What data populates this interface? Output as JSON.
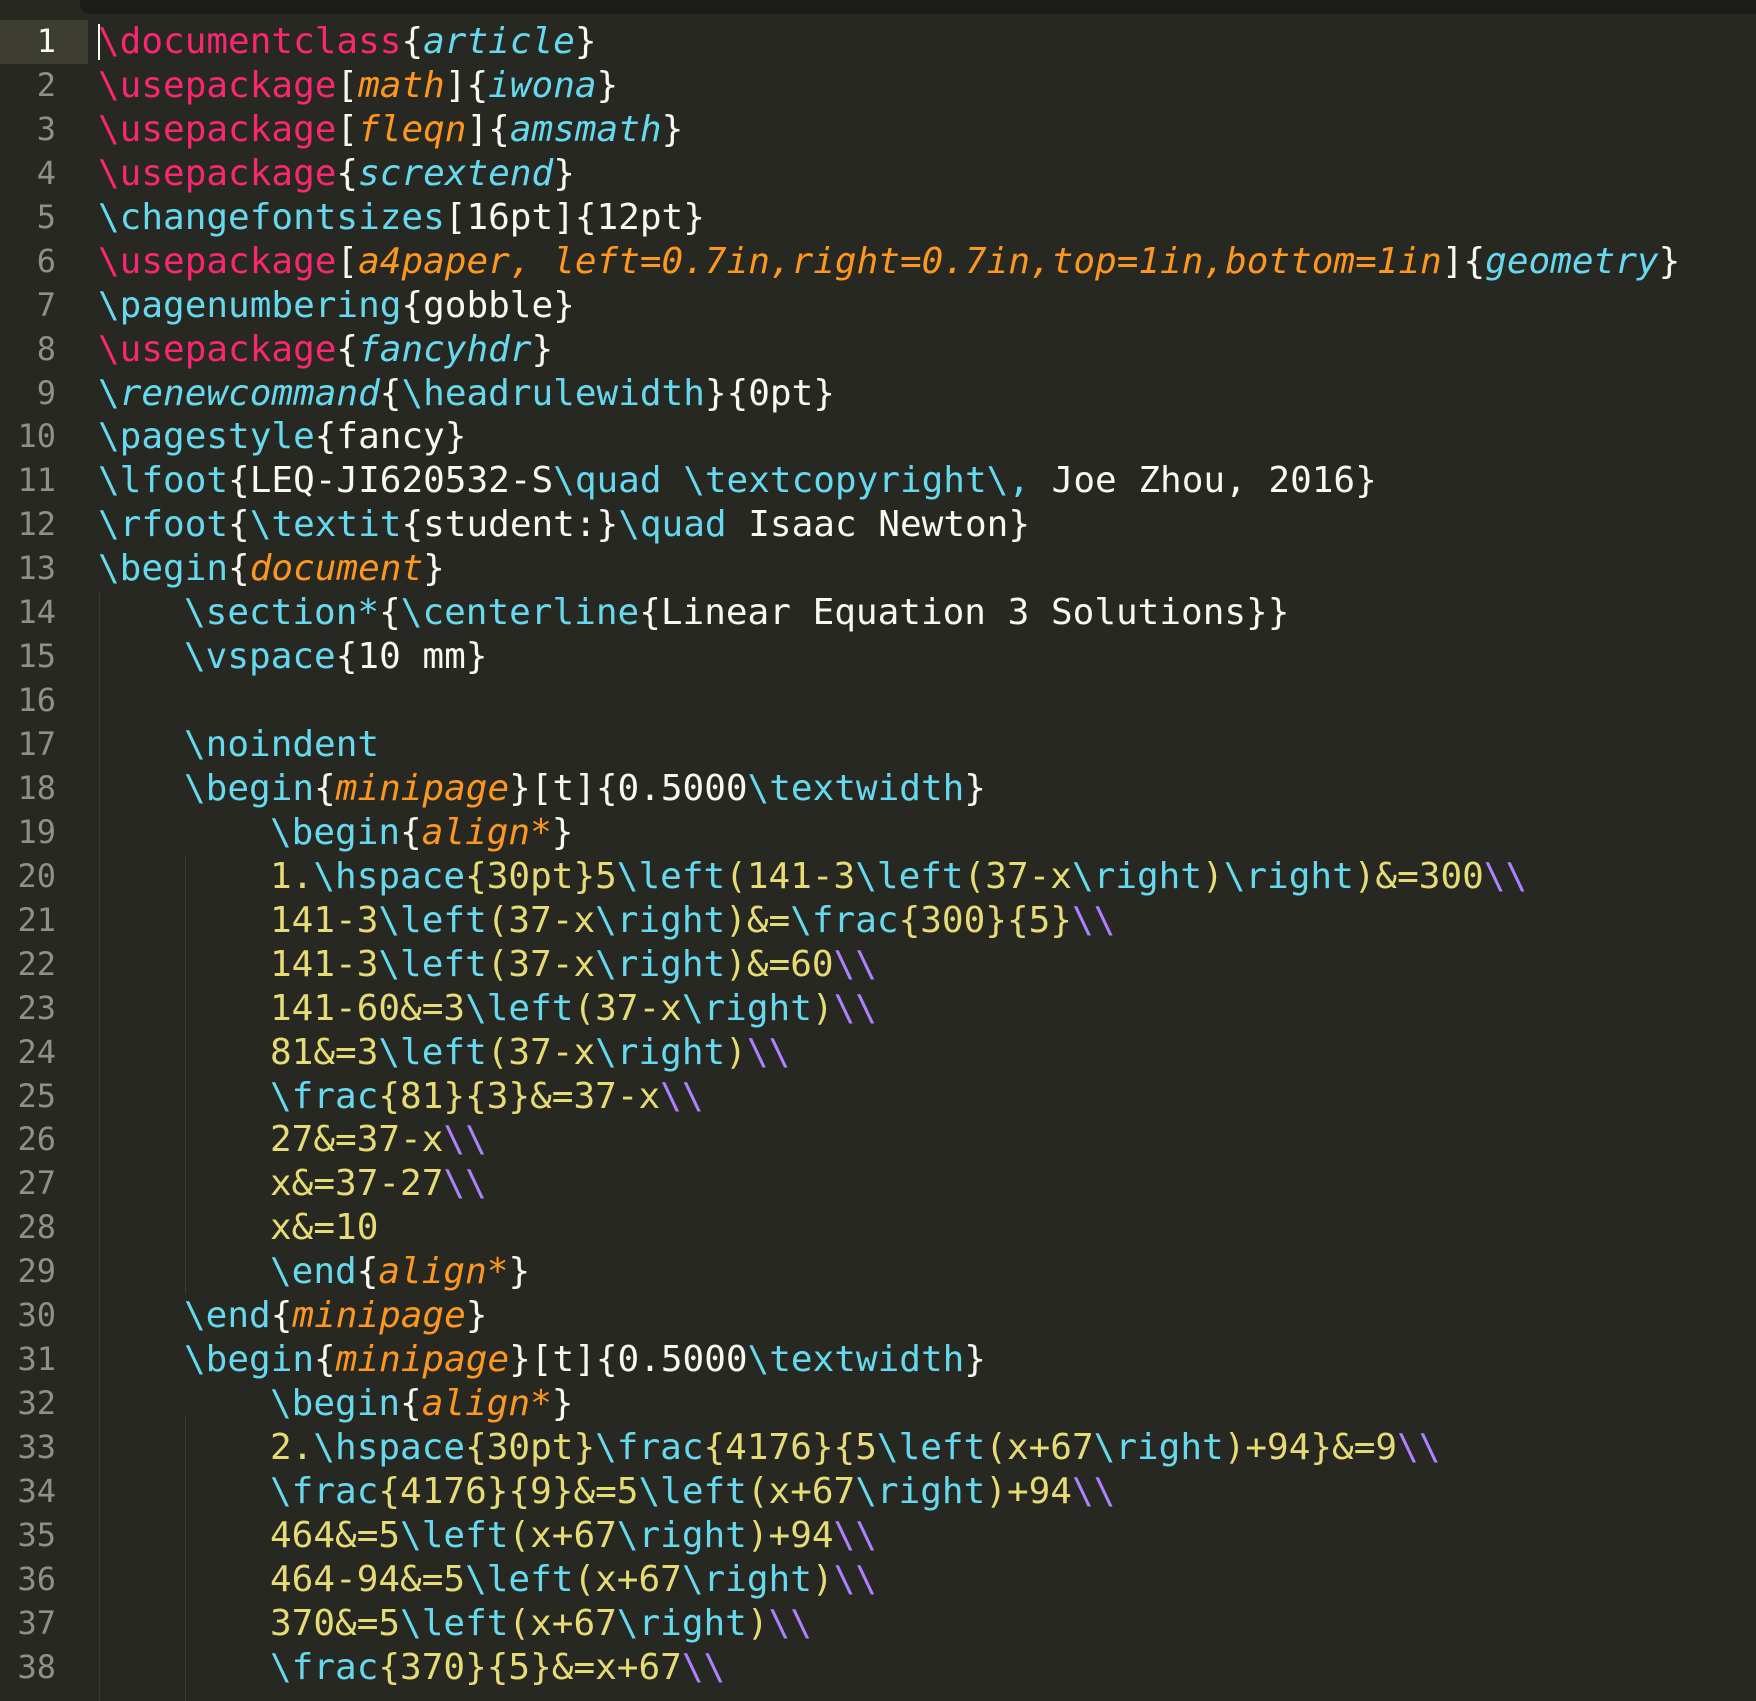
{
  "editor": {
    "language": "LaTeX",
    "theme": "Monokai",
    "active_line": "1",
    "colors": {
      "background": "#272822",
      "keyword": "#f92672",
      "command": "#66d9ef",
      "option": "#fd971f",
      "text": "#f8f8f2",
      "math": "#e6db74",
      "linebreak": "#ae81ff",
      "gutter_text": "#8f908a"
    },
    "line_numbers": [
      "1",
      "2",
      "3",
      "4",
      "5",
      "6",
      "7",
      "8",
      "9",
      "10",
      "11",
      "12",
      "13",
      "14",
      "15",
      "16",
      "17",
      "18",
      "19",
      "20",
      "21",
      "22",
      "23",
      "24",
      "25",
      "26",
      "27",
      "28",
      "29",
      "30",
      "31",
      "32",
      "33",
      "34",
      "35",
      "36",
      "37",
      "38"
    ]
  },
  "lines": [
    [
      {
        "c": "k",
        "t": "\\documentclass"
      },
      {
        "c": "w",
        "t": "{"
      },
      {
        "c": "ci",
        "t": "article"
      },
      {
        "c": "w",
        "t": "}"
      }
    ],
    [
      {
        "c": "k",
        "t": "\\usepackage"
      },
      {
        "c": "w",
        "t": "["
      },
      {
        "c": "o",
        "t": "math"
      },
      {
        "c": "w",
        "t": "]{"
      },
      {
        "c": "ci",
        "t": "iwona"
      },
      {
        "c": "w",
        "t": "}"
      }
    ],
    [
      {
        "c": "k",
        "t": "\\usepackage"
      },
      {
        "c": "w",
        "t": "["
      },
      {
        "c": "o",
        "t": "fleqn"
      },
      {
        "c": "w",
        "t": "]{"
      },
      {
        "c": "ci",
        "t": "amsmath"
      },
      {
        "c": "w",
        "t": "}"
      }
    ],
    [
      {
        "c": "k",
        "t": "\\usepackage"
      },
      {
        "c": "w",
        "t": "{"
      },
      {
        "c": "ci",
        "t": "scrextend"
      },
      {
        "c": "w",
        "t": "}"
      }
    ],
    [
      {
        "c": "c",
        "t": "\\changefontsizes"
      },
      {
        "c": "w",
        "t": "[16pt]{12pt}"
      }
    ],
    [
      {
        "c": "k",
        "t": "\\usepackage"
      },
      {
        "c": "w",
        "t": "["
      },
      {
        "c": "o",
        "t": "a4paper, left=0.7in,right=0.7in,top=1in,bottom=1in"
      },
      {
        "c": "w",
        "t": "]{"
      },
      {
        "c": "ci",
        "t": "geometry"
      },
      {
        "c": "w",
        "t": "}"
      }
    ],
    [
      {
        "c": "c",
        "t": "\\pagenumbering"
      },
      {
        "c": "w",
        "t": "{gobble}"
      }
    ],
    [
      {
        "c": "k",
        "t": "\\usepackage"
      },
      {
        "c": "w",
        "t": "{"
      },
      {
        "c": "ci",
        "t": "fancyhdr"
      },
      {
        "c": "w",
        "t": "}"
      }
    ],
    [
      {
        "c": "c",
        "t": "\\"
      },
      {
        "c": "ci",
        "t": "renewcommand"
      },
      {
        "c": "w",
        "t": "{"
      },
      {
        "c": "c",
        "t": "\\headrulewidth"
      },
      {
        "c": "w",
        "t": "}{0pt}"
      }
    ],
    [
      {
        "c": "c",
        "t": "\\pagestyle"
      },
      {
        "c": "w",
        "t": "{fancy}"
      }
    ],
    [
      {
        "c": "c",
        "t": "\\lfoot"
      },
      {
        "c": "w",
        "t": "{LEQ-JI620532-S"
      },
      {
        "c": "c",
        "t": "\\quad \\textcopyright\\,"
      },
      {
        "c": "w",
        "t": " Joe Zhou, 2016}"
      }
    ],
    [
      {
        "c": "c",
        "t": "\\rfoot"
      },
      {
        "c": "w",
        "t": "{"
      },
      {
        "c": "c",
        "t": "\\textit"
      },
      {
        "c": "w",
        "t": "{student:}"
      },
      {
        "c": "c",
        "t": "\\quad"
      },
      {
        "c": "w",
        "t": " Isaac Newton}"
      }
    ],
    [
      {
        "c": "c",
        "t": "\\begin"
      },
      {
        "c": "w",
        "t": "{"
      },
      {
        "c": "o",
        "t": "document"
      },
      {
        "c": "w",
        "t": "}"
      }
    ],
    [
      {
        "c": "c",
        "t": "\\section*"
      },
      {
        "c": "w",
        "t": "{"
      },
      {
        "c": "c",
        "t": "\\centerline"
      },
      {
        "c": "w",
        "t": "{Linear Equation 3 Solutions}}"
      }
    ],
    [
      {
        "c": "c",
        "t": "\\vspace"
      },
      {
        "c": "w",
        "t": "{10 mm}"
      }
    ],
    [],
    [
      {
        "c": "c",
        "t": "\\noindent"
      }
    ],
    [
      {
        "c": "c",
        "t": "\\begin"
      },
      {
        "c": "w",
        "t": "{"
      },
      {
        "c": "o",
        "t": "minipage"
      },
      {
        "c": "w",
        "t": "}[t]{0.5000"
      },
      {
        "c": "c",
        "t": "\\textwidth"
      },
      {
        "c": "w",
        "t": "}"
      }
    ],
    [
      {
        "c": "c",
        "t": "\\begin"
      },
      {
        "c": "w",
        "t": "{"
      },
      {
        "c": "o",
        "t": "align*"
      },
      {
        "c": "w",
        "t": "}"
      }
    ],
    [
      {
        "c": "y",
        "t": "1."
      },
      {
        "c": "c",
        "t": "\\hspace"
      },
      {
        "c": "y",
        "t": "{30pt}5"
      },
      {
        "c": "c",
        "t": "\\left"
      },
      {
        "c": "y",
        "t": "(141-3"
      },
      {
        "c": "c",
        "t": "\\left"
      },
      {
        "c": "y",
        "t": "(37-x"
      },
      {
        "c": "c",
        "t": "\\right"
      },
      {
        "c": "y",
        "t": ")"
      },
      {
        "c": "c",
        "t": "\\right"
      },
      {
        "c": "y",
        "t": ")&=300"
      },
      {
        "c": "p",
        "t": "\\\\"
      }
    ],
    [
      {
        "c": "y",
        "t": "141-3"
      },
      {
        "c": "c",
        "t": "\\left"
      },
      {
        "c": "y",
        "t": "(37-x"
      },
      {
        "c": "c",
        "t": "\\right"
      },
      {
        "c": "y",
        "t": ")&="
      },
      {
        "c": "c",
        "t": "\\frac"
      },
      {
        "c": "y",
        "t": "{300}{5}"
      },
      {
        "c": "p",
        "t": "\\\\"
      }
    ],
    [
      {
        "c": "y",
        "t": "141-3"
      },
      {
        "c": "c",
        "t": "\\left"
      },
      {
        "c": "y",
        "t": "(37-x"
      },
      {
        "c": "c",
        "t": "\\right"
      },
      {
        "c": "y",
        "t": ")&=60"
      },
      {
        "c": "p",
        "t": "\\\\"
      }
    ],
    [
      {
        "c": "y",
        "t": "141-60&=3"
      },
      {
        "c": "c",
        "t": "\\left"
      },
      {
        "c": "y",
        "t": "(37-x"
      },
      {
        "c": "c",
        "t": "\\right"
      },
      {
        "c": "y",
        "t": ")"
      },
      {
        "c": "p",
        "t": "\\\\"
      }
    ],
    [
      {
        "c": "y",
        "t": "81&=3"
      },
      {
        "c": "c",
        "t": "\\left"
      },
      {
        "c": "y",
        "t": "(37-x"
      },
      {
        "c": "c",
        "t": "\\right"
      },
      {
        "c": "y",
        "t": ")"
      },
      {
        "c": "p",
        "t": "\\\\"
      }
    ],
    [
      {
        "c": "c",
        "t": "\\frac"
      },
      {
        "c": "y",
        "t": "{81}{3}&=37-x"
      },
      {
        "c": "p",
        "t": "\\\\"
      }
    ],
    [
      {
        "c": "y",
        "t": "27&=37-x"
      },
      {
        "c": "p",
        "t": "\\\\"
      }
    ],
    [
      {
        "c": "y",
        "t": "x&=37-27"
      },
      {
        "c": "p",
        "t": "\\\\"
      }
    ],
    [
      {
        "c": "y",
        "t": "x&=10"
      }
    ],
    [
      {
        "c": "c",
        "t": "\\end"
      },
      {
        "c": "w",
        "t": "{"
      },
      {
        "c": "o",
        "t": "align*"
      },
      {
        "c": "w",
        "t": "}"
      }
    ],
    [
      {
        "c": "c",
        "t": "\\end"
      },
      {
        "c": "w",
        "t": "{"
      },
      {
        "c": "o",
        "t": "minipage"
      },
      {
        "c": "w",
        "t": "}"
      }
    ],
    [
      {
        "c": "c",
        "t": "\\begin"
      },
      {
        "c": "w",
        "t": "{"
      },
      {
        "c": "o",
        "t": "minipage"
      },
      {
        "c": "w",
        "t": "}[t]{0.5000"
      },
      {
        "c": "c",
        "t": "\\textwidth"
      },
      {
        "c": "w",
        "t": "}"
      }
    ],
    [
      {
        "c": "c",
        "t": "\\begin"
      },
      {
        "c": "w",
        "t": "{"
      },
      {
        "c": "o",
        "t": "align*"
      },
      {
        "c": "w",
        "t": "}"
      }
    ],
    [
      {
        "c": "y",
        "t": "2."
      },
      {
        "c": "c",
        "t": "\\hspace"
      },
      {
        "c": "y",
        "t": "{30pt}"
      },
      {
        "c": "c",
        "t": "\\frac"
      },
      {
        "c": "y",
        "t": "{4176}{5"
      },
      {
        "c": "c",
        "t": "\\left"
      },
      {
        "c": "y",
        "t": "(x+67"
      },
      {
        "c": "c",
        "t": "\\right"
      },
      {
        "c": "y",
        "t": ")+94}&=9"
      },
      {
        "c": "p",
        "t": "\\\\"
      }
    ],
    [
      {
        "c": "c",
        "t": "\\frac"
      },
      {
        "c": "y",
        "t": "{4176}{9}&=5"
      },
      {
        "c": "c",
        "t": "\\left"
      },
      {
        "c": "y",
        "t": "(x+67"
      },
      {
        "c": "c",
        "t": "\\right"
      },
      {
        "c": "y",
        "t": ")+94"
      },
      {
        "c": "p",
        "t": "\\\\"
      }
    ],
    [
      {
        "c": "y",
        "t": "464&=5"
      },
      {
        "c": "c",
        "t": "\\left"
      },
      {
        "c": "y",
        "t": "(x+67"
      },
      {
        "c": "c",
        "t": "\\right"
      },
      {
        "c": "y",
        "t": ")+94"
      },
      {
        "c": "p",
        "t": "\\\\"
      }
    ],
    [
      {
        "c": "y",
        "t": "464-94&=5"
      },
      {
        "c": "c",
        "t": "\\left"
      },
      {
        "c": "y",
        "t": "(x+67"
      },
      {
        "c": "c",
        "t": "\\right"
      },
      {
        "c": "y",
        "t": ")"
      },
      {
        "c": "p",
        "t": "\\\\"
      }
    ],
    [
      {
        "c": "y",
        "t": "370&=5"
      },
      {
        "c": "c",
        "t": "\\left"
      },
      {
        "c": "y",
        "t": "(x+67"
      },
      {
        "c": "c",
        "t": "\\right"
      },
      {
        "c": "y",
        "t": ")"
      },
      {
        "c": "p",
        "t": "\\\\"
      }
    ],
    [
      {
        "c": "c",
        "t": "\\frac"
      },
      {
        "c": "y",
        "t": "{370}{5}&=x+67"
      },
      {
        "c": "p",
        "t": "\\\\"
      }
    ]
  ]
}
